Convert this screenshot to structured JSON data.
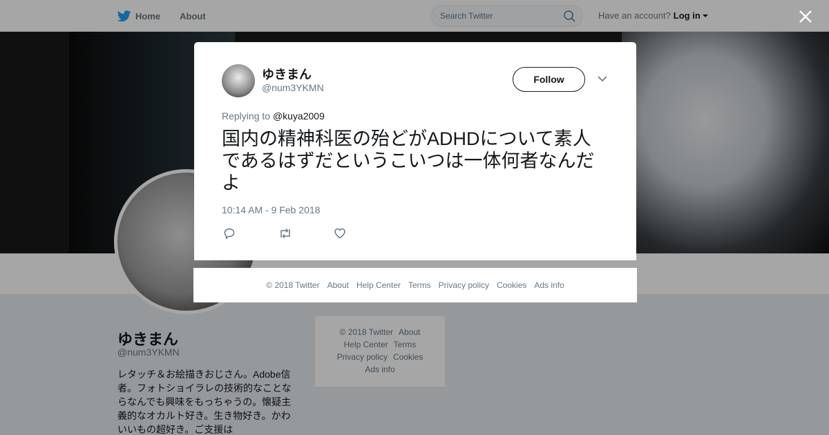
{
  "nav": {
    "home": "Home",
    "about": "About",
    "search_placeholder": "Search Twitter",
    "have_account": "Have an account?",
    "login": "Log in"
  },
  "profile": {
    "name": "ゆきまん",
    "handle": "@num3YKMN",
    "bio": "レタッチ＆お絵描きおじさん。Adobe信者。フォトショイラレの技術的なことならなんでも興味をもっちゃうの。懐疑主義的なオカルト好き。生き物好き。かわいいもの超好き。ご支援は"
  },
  "side_footer": {
    "items": [
      "© 2018 Twitter",
      "About",
      "Help Center",
      "Terms",
      "Privacy policy",
      "Cookies",
      "Ads info"
    ]
  },
  "tweet": {
    "name": "ゆきまん",
    "handle": "@num3YKMN",
    "follow_label": "Follow",
    "replying_label": "Replying to",
    "replying_to": "@kuya2009",
    "text": "国内の精神科医の殆どがADHDについて素人であるはずだというこいつは一体何者なんだよ",
    "timestamp": "10:14 AM - 9 Feb 2018"
  },
  "modal_footer": {
    "items": [
      "© 2018 Twitter",
      "About",
      "Help Center",
      "Terms",
      "Privacy policy",
      "Cookies",
      "Ads info"
    ]
  },
  "colors": {
    "brand": "#1da1f2",
    "text": "#14171a",
    "muted": "#657786"
  }
}
